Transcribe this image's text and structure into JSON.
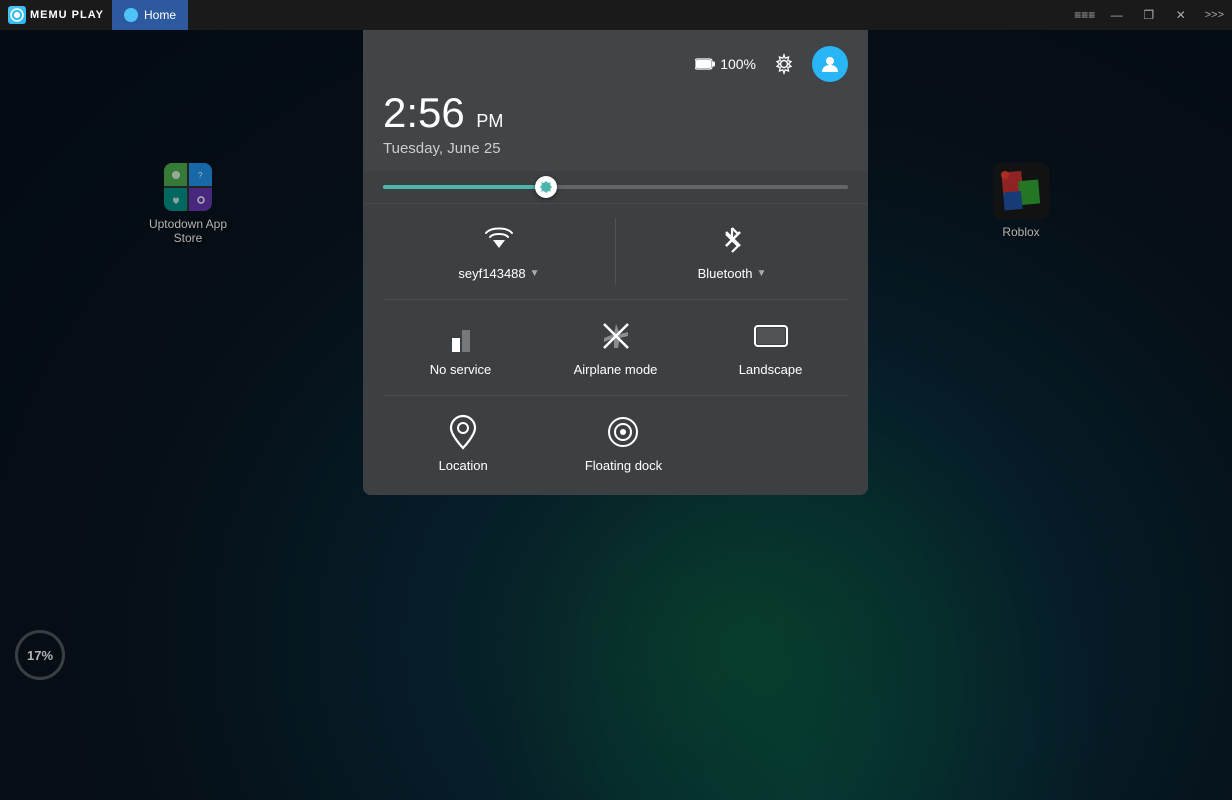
{
  "titlebar": {
    "logo_text": "MEMU PLAY",
    "tab_label": "Home",
    "btn_minimize": "—",
    "btn_restore": "❐",
    "btn_close": "✕",
    "btn_more": ">>>",
    "btn_settings": "≡≡≡"
  },
  "desktop": {
    "app1_label": "Uptodown App Store",
    "app2_label": "Roblox",
    "battery_percent": "17%"
  },
  "panel": {
    "battery_label": "100%",
    "time": "2:56",
    "ampm": "PM",
    "date": "Tuesday, June 25",
    "wifi_label": "seyf143488",
    "bluetooth_label": "Bluetooth",
    "no_service_label": "No service",
    "airplane_label": "Airplane mode",
    "landscape_label": "Landscape",
    "location_label": "Location",
    "floating_dock_label": "Floating dock"
  }
}
